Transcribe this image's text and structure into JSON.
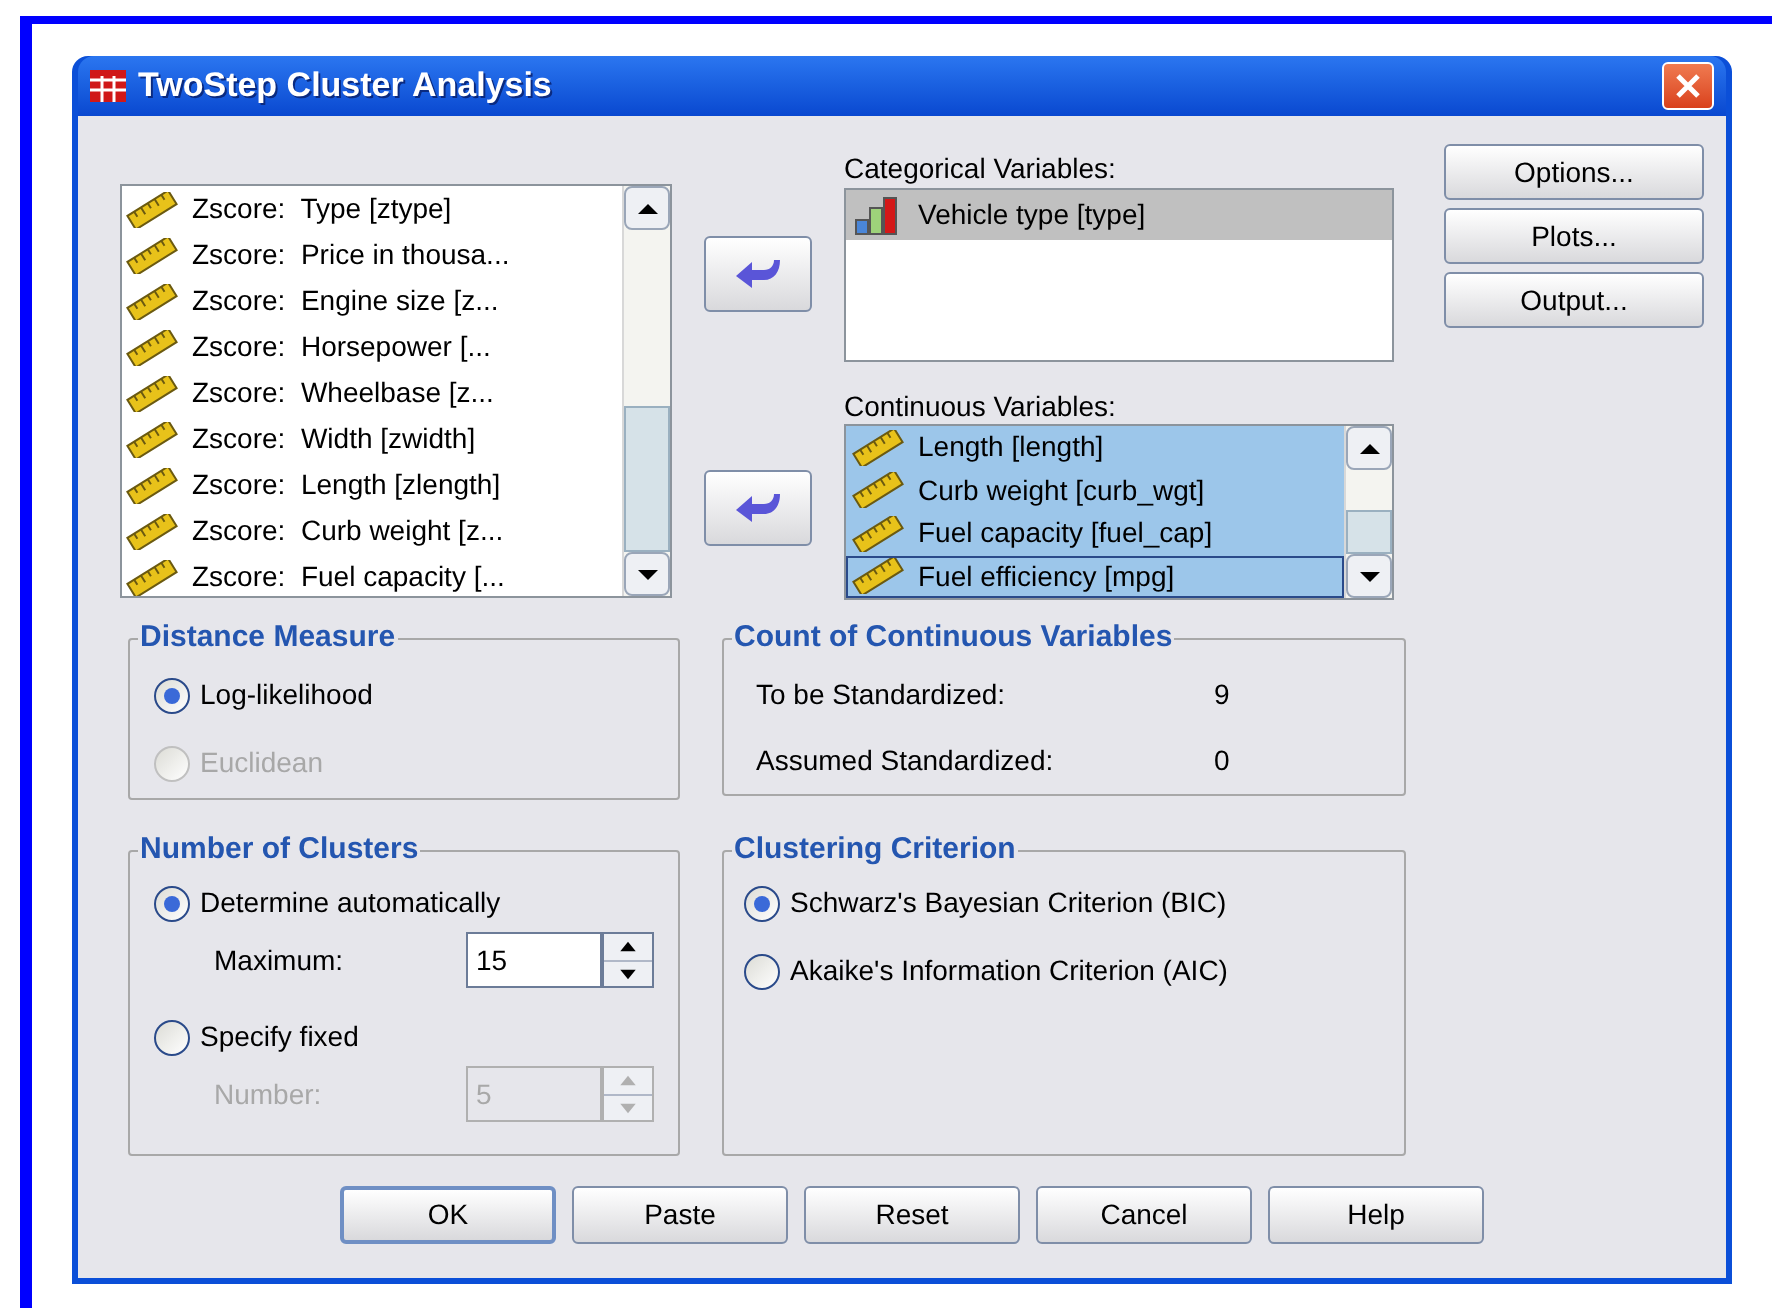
{
  "window": {
    "title": "TwoStep Cluster Analysis"
  },
  "source_variables": {
    "items": [
      {
        "label": "Zscore:  Type [ztype]",
        "selected": false
      },
      {
        "label": "Zscore:  Price in thousa...",
        "selected": false
      },
      {
        "label": "Zscore:  Engine size [z...",
        "selected": false
      },
      {
        "label": "Zscore:  Horsepower [...",
        "selected": false
      },
      {
        "label": "Zscore:  Wheelbase [z...",
        "selected": false
      },
      {
        "label": "Zscore:  Width [zwidth]",
        "selected": false
      },
      {
        "label": "Zscore:  Length [zlength]",
        "selected": false
      },
      {
        "label": "Zscore:  Curb weight [z...",
        "selected": false
      },
      {
        "label": "Zscore:  Fuel capacity [...",
        "selected": false
      }
    ]
  },
  "categorical": {
    "label": "Categorical Variables:",
    "items": [
      {
        "label": "Vehicle type [type]",
        "selected": true,
        "focused": false
      }
    ]
  },
  "continuous": {
    "label": "Continuous Variables:",
    "items": [
      {
        "label": "Length [length]",
        "selected": true,
        "focused": false
      },
      {
        "label": "Curb weight [curb_wgt]",
        "selected": true,
        "focused": false
      },
      {
        "label": "Fuel capacity [fuel_cap]",
        "selected": true,
        "focused": false
      },
      {
        "label": "Fuel efficiency [mpg]",
        "selected": true,
        "focused": true
      }
    ]
  },
  "side_buttons": [
    {
      "label": "Options..."
    },
    {
      "label": "Plots..."
    },
    {
      "label": "Output..."
    }
  ],
  "distance_measure": {
    "title": "Distance Measure",
    "options": [
      {
        "label": "Log-likelihood",
        "selected": true,
        "disabled": false
      },
      {
        "label": "Euclidean",
        "selected": false,
        "disabled": true
      }
    ]
  },
  "count_of_continuous": {
    "title": "Count of Continuous Variables",
    "rows": [
      {
        "label": "To be Standardized:",
        "value": "9"
      },
      {
        "label": "Assumed Standardized:",
        "value": "0"
      }
    ]
  },
  "number_of_clusters": {
    "title": "Number of Clusters",
    "options": [
      {
        "label": "Determine automatically",
        "selected": true,
        "disabled": false,
        "spin": {
          "label": "Maximum:",
          "value": "15",
          "disabled": false
        }
      },
      {
        "label": "Specify fixed",
        "selected": false,
        "disabled": false,
        "spin": {
          "label": "Number:",
          "value": "5",
          "disabled": true
        }
      }
    ]
  },
  "clustering_criterion": {
    "title": "Clustering Criterion",
    "options": [
      {
        "label": "Schwarz's Bayesian Criterion (BIC)",
        "selected": true,
        "disabled": false
      },
      {
        "label": "Akaike's Information Criterion (AIC)",
        "selected": false,
        "disabled": false
      }
    ]
  },
  "buttons": [
    {
      "label": "OK",
      "default": true
    },
    {
      "label": "Paste",
      "default": false
    },
    {
      "label": "Reset",
      "default": false
    },
    {
      "label": "Cancel",
      "default": false
    },
    {
      "label": "Help",
      "default": false
    }
  ]
}
